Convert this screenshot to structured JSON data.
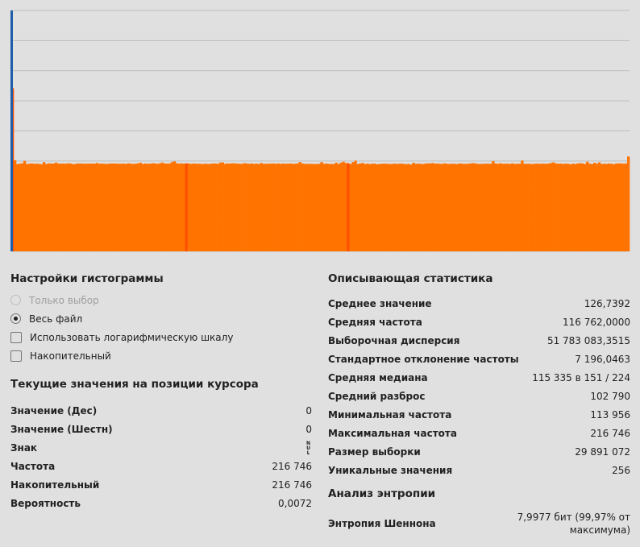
{
  "chart_data": {
    "type": "bar",
    "x": [
      0,
      255
    ],
    "ylim": [
      0,
      320000
    ],
    "grid": true,
    "cursor_index": 0,
    "colors": {
      "bar": "#ff7300",
      "bar_highlight": "#ff4d00",
      "grid": "#bdbdbd",
      "cursor": "#1e5ea8",
      "background": "#e0e0e0"
    },
    "values": [
      216746,
      121000,
      116000,
      116500,
      117000,
      120200,
      116000,
      116500,
      116800,
      116300,
      116500,
      116200,
      115800,
      118600,
      116100,
      116900,
      116600,
      116700,
      118000,
      116700,
      116500,
      116700,
      116400,
      117000,
      116700,
      115900,
      116000,
      116800,
      116700,
      116500,
      116400,
      116500,
      116600,
      116500,
      116500,
      117400,
      116400,
      116600,
      116400,
      116100,
      116500,
      116700,
      116700,
      116600,
      116400,
      116400,
      116600,
      116200,
      117000,
      116400,
      116200,
      116400,
      116900,
      117800,
      116100,
      116700,
      116300,
      116500,
      117000,
      116800,
      116300,
      116900,
      118000,
      116700,
      116700,
      116700,
      118500,
      119600,
      117100,
      116600,
      116900,
      116500,
      116900,
      116700,
      116200,
      116700,
      116400,
      116400,
      116200,
      116100,
      116500,
      116000,
      116400,
      116700,
      116800,
      116200,
      118000,
      118200,
      116300,
      116800,
      116600,
      117000,
      116900,
      116600,
      116400,
      116200,
      117200,
      116700,
      116300,
      116800,
      116200,
      116500,
      116100,
      117400,
      116300,
      116400,
      116400,
      116600,
      116800,
      116300,
      116800,
      116200,
      116600,
      116400,
      116500,
      116700,
      116200,
      116400,
      116800,
      118700,
      116700,
      116200,
      116200,
      116300,
      116200,
      116000,
      116100,
      116300,
      118600,
      116300,
      116600,
      116200,
      116100,
      116000,
      117800,
      116100,
      117900,
      119100,
      117500,
      117000,
      116100,
      118700,
      120400,
      116100,
      116800,
      117400,
      116000,
      116600,
      115900,
      116500,
      116500,
      115600,
      116100,
      116400,
      116500,
      116400,
      116100,
      116000,
      116600,
      116200,
      116400,
      116600,
      116200,
      115800,
      116200,
      115300,
      117700,
      116300,
      116600,
      116200,
      116000,
      116600,
      116900,
      116800,
      117400,
      116400,
      116800,
      116300,
      116200,
      117000,
      116300,
      116100,
      116400,
      116300,
      116000,
      116700,
      116500,
      116200,
      116300,
      116500,
      117000,
      117200,
      116500,
      116200,
      116200,
      116300,
      116500,
      116400,
      116400,
      119900,
      116700,
      116400,
      117000,
      116300,
      116400,
      116500,
      116200,
      116900,
      116100,
      116400,
      116400,
      120600,
      116300,
      116300,
      116400,
      116000,
      116200,
      116600,
      116300,
      116400,
      116500,
      116200,
      116700,
      117400,
      118300,
      116700,
      116400,
      116600,
      116000,
      116600,
      116400,
      115700,
      116500,
      116000,
      116700,
      117100,
      116800,
      116100,
      119100,
      116500,
      116000,
      117700,
      116400,
      118300,
      116000,
      116400,
      116200,
      116700,
      116400,
      115700,
      116700,
      116900,
      116800,
      116500,
      116800,
      126000
    ],
    "highlight_indices": [
      0,
      72,
      139
    ]
  },
  "histogram_settings": {
    "title": "Настройки гистограммы",
    "options": [
      {
        "type": "radio",
        "label": "Только выбор",
        "checked": false,
        "disabled": true
      },
      {
        "type": "radio",
        "label": "Весь файл",
        "checked": true,
        "disabled": false
      },
      {
        "type": "checkbox",
        "label": "Использовать логарифмическую шкалу",
        "checked": false,
        "disabled": false
      },
      {
        "type": "checkbox",
        "label": "Накопительный",
        "checked": false,
        "disabled": false
      }
    ]
  },
  "cursor_values": {
    "title": "Текущие значения на позиции курсора",
    "rows": [
      {
        "label": "Значение (Дес)",
        "value": "0"
      },
      {
        "label": "Значение (Шестн)",
        "value": "0"
      },
      {
        "label": "Знак",
        "value": "NUL"
      },
      {
        "label": "Частота",
        "value": "216 746"
      },
      {
        "label": "Накопительный",
        "value": "216 746"
      },
      {
        "label": "Вероятность",
        "value": "0,0072"
      }
    ]
  },
  "descriptive_stats": {
    "title": "Описывающая статистика",
    "rows": [
      {
        "label": "Среднее значение",
        "value": "126,7392"
      },
      {
        "label": "Средняя частота",
        "value": "116 762,0000"
      },
      {
        "label": "Выборочная дисперсия",
        "value": "51 783 083,3515"
      },
      {
        "label": "Стандартное отклонение частоты",
        "value": "7 196,0463"
      },
      {
        "label": "Средняя медиана",
        "value": "115 335 в 151 / 224"
      },
      {
        "label": "Средний разброс",
        "value": "102 790"
      },
      {
        "label": "Минимальная частота",
        "value": "113 956"
      },
      {
        "label": "Максимальная частота",
        "value": "216 746"
      },
      {
        "label": "Размер выборки",
        "value": "29 891 072"
      },
      {
        "label": "Уникальные значения",
        "value": "256"
      }
    ]
  },
  "entropy": {
    "title": "Анализ энтропии",
    "label": "Энтропия Шеннона",
    "value": "7,9977 бит (99,97% от максимума)"
  }
}
